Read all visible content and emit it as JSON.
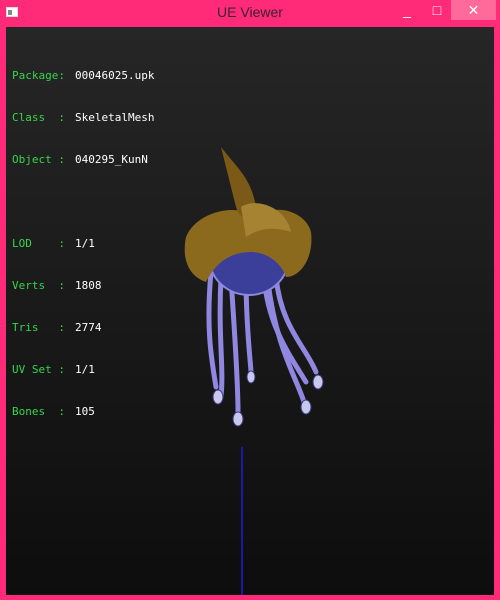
{
  "window": {
    "title": "UE Viewer",
    "minimize": "_",
    "maximize": "□",
    "close": "✕"
  },
  "info": {
    "package": {
      "label": "Package:",
      "value": "00046025.upk"
    },
    "class": {
      "label": "Class  :",
      "value": "SkeletalMesh"
    },
    "object": {
      "label": "Object :",
      "value": "040295_KunN"
    },
    "lod": {
      "label": "LOD    :",
      "value": "1/1"
    },
    "verts": {
      "label": "Verts  :",
      "value": "1808"
    },
    "tris": {
      "label": "Tris   :",
      "value": "2774"
    },
    "uvset": {
      "label": "UV Set :",
      "value": "1/1"
    },
    "bones": {
      "label": "Bones  :",
      "value": "105"
    }
  },
  "colors": {
    "frame": "#ff2a78",
    "label": "#35d64a",
    "value": "#ffffff",
    "turban": "#8b6a1e",
    "tassels": "#8f87e0",
    "axis": "#1a1aa8"
  },
  "icons": [
    "app-icon",
    "minimize-icon",
    "maximize-icon",
    "close-icon"
  ]
}
